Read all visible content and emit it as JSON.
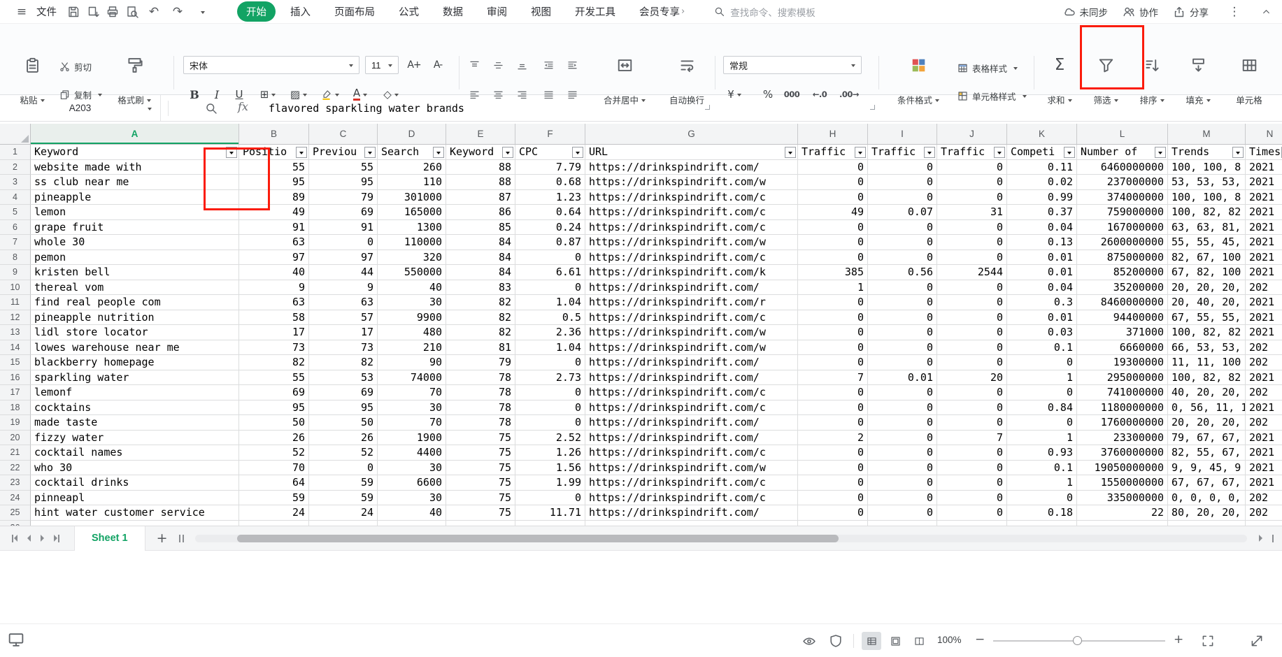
{
  "colors": {
    "accent_green": "#12a364",
    "annotation_red": "#fb1c0c"
  },
  "glyphs": {
    "hamburger": "≡",
    "undo": "↶",
    "redo": "↷",
    "kebab": "⋮",
    "chev_right": "›",
    "bold": "B",
    "italic": "I",
    "underline": "U",
    "borders": "⊞",
    "shading": "▨",
    "clear_format": "◇",
    "font_color": "A",
    "grow_font": "A+",
    "shrink_font": "A-",
    "sigma": "Σ",
    "currency": "¥",
    "percent": "%",
    "thousands": "000",
    "add_decimal": "←.0",
    "remove_decimal": ".00→",
    "fx": "fx",
    "plus": "+",
    "minus": "−"
  },
  "menubar": {
    "file": "文件",
    "tabs": [
      {
        "label": "开始",
        "active": true
      },
      {
        "label": "插入"
      },
      {
        "label": "页面布局"
      },
      {
        "label": "公式"
      },
      {
        "label": "数据"
      },
      {
        "label": "审阅"
      },
      {
        "label": "视图"
      },
      {
        "label": "开发工具"
      },
      {
        "label": "会员专享"
      }
    ],
    "search_placeholder": "查找命令、搜索模板",
    "sync_status": "未同步",
    "collaborate": "协作",
    "share": "分享"
  },
  "ribbon": {
    "paste": "粘贴",
    "cut": "剪切",
    "copy": "复制",
    "format_painter": "格式刷",
    "font_name": "宋体",
    "font_size": "11",
    "merge_center": "合并居中",
    "wrap_text": "自动换行",
    "number_format": "常规",
    "conditional_format": "条件格式",
    "table_style": "表格样式",
    "cell_style": "单元格样式",
    "sum": "求和",
    "filter": "筛选",
    "sort": "排序",
    "fill": "填充",
    "cells": "单元格"
  },
  "formula_bar": {
    "cell_ref": "A203",
    "content": "flavored sparkling water brands"
  },
  "sheet": {
    "active_column": "A",
    "column_letters": [
      "A",
      "B",
      "C",
      "D",
      "E",
      "F",
      "G",
      "H",
      "I",
      "J",
      "K",
      "L",
      "M",
      "N"
    ],
    "header_row": {
      "n": 1,
      "cells": [
        "Keyword",
        "Positio",
        "Previou",
        "Search",
        "Keyword",
        "CPC",
        "URL",
        "Traffic",
        "Traffic",
        "Traffic",
        "Competi",
        "Number of",
        "Trends",
        "Timest"
      ]
    },
    "rows": [
      {
        "n": 2,
        "cells": [
          "website made with",
          "55",
          "55",
          "260",
          "88",
          "7.79",
          "https://drinkspindrift.com/",
          "0",
          "0",
          "0",
          "0.11",
          "6460000000",
          "100, 100, 8",
          "2021"
        ]
      },
      {
        "n": 3,
        "cells": [
          "ss club near me",
          "95",
          "95",
          "110",
          "88",
          "0.68",
          "https://drinkspindrift.com/w",
          "0",
          "0",
          "0",
          "0.02",
          "237000000",
          "53, 53, 53,",
          "2021"
        ]
      },
      {
        "n": 4,
        "cells": [
          "pineapple",
          "89",
          "79",
          "301000",
          "87",
          "1.23",
          "https://drinkspindrift.com/c",
          "0",
          "0",
          "0",
          "0.99",
          "374000000",
          "100, 100, 8",
          "2021"
        ]
      },
      {
        "n": 5,
        "cells": [
          "lemon",
          "49",
          "69",
          "165000",
          "86",
          "0.64",
          "https://drinkspindrift.com/c",
          "49",
          "0.07",
          "31",
          "0.37",
          "759000000",
          "100, 82, 82",
          "2021"
        ]
      },
      {
        "n": 6,
        "cells": [
          "grape fruit",
          "91",
          "91",
          "1300",
          "85",
          "0.24",
          "https://drinkspindrift.com/c",
          "0",
          "0",
          "0",
          "0.04",
          "167000000",
          "63, 63, 81,",
          "2021"
        ]
      },
      {
        "n": 7,
        "cells": [
          "whole 30",
          "63",
          "0",
          "110000",
          "84",
          "0.87",
          "https://drinkspindrift.com/w",
          "0",
          "0",
          "0",
          "0.13",
          "2600000000",
          "55, 55, 45,",
          "2021"
        ]
      },
      {
        "n": 8,
        "cells": [
          "pemon",
          "97",
          "97",
          "320",
          "84",
          "0",
          "https://drinkspindrift.com/c",
          "0",
          "0",
          "0",
          "0.01",
          "875000000",
          "82, 67, 100",
          "2021"
        ]
      },
      {
        "n": 9,
        "cells": [
          "kristen bell",
          "40",
          "44",
          "550000",
          "84",
          "6.61",
          "https://drinkspindrift.com/k",
          "385",
          "0.56",
          "2544",
          "0.01",
          "85200000",
          "67, 82, 100",
          "2021"
        ]
      },
      {
        "n": 10,
        "cells": [
          "thereal vom",
          "9",
          "9",
          "40",
          "83",
          "0",
          "https://drinkspindrift.com/",
          "1",
          "0",
          "0",
          "0.04",
          "35200000",
          "20, 20, 20,",
          "202"
        ]
      },
      {
        "n": 11,
        "cells": [
          "find real people com",
          "63",
          "63",
          "30",
          "82",
          "1.04",
          "https://drinkspindrift.com/r",
          "0",
          "0",
          "0",
          "0.3",
          "8460000000",
          "20, 40, 20,",
          "2021"
        ]
      },
      {
        "n": 12,
        "cells": [
          "pineapple nutrition",
          "58",
          "57",
          "9900",
          "82",
          "0.5",
          "https://drinkspindrift.com/c",
          "0",
          "0",
          "0",
          "0.01",
          "94400000",
          "67, 55, 55,",
          "2021"
        ]
      },
      {
        "n": 13,
        "cells": [
          "lidl store locator",
          "17",
          "17",
          "480",
          "82",
          "2.36",
          "https://drinkspindrift.com/w",
          "0",
          "0",
          "0",
          "0.03",
          "371000",
          "100, 82, 82",
          "2021"
        ]
      },
      {
        "n": 14,
        "cells": [
          "lowes warehouse near me",
          "73",
          "73",
          "210",
          "81",
          "1.04",
          "https://drinkspindrift.com/w",
          "0",
          "0",
          "0",
          "0.1",
          "6660000",
          "66, 53, 53,",
          "202"
        ]
      },
      {
        "n": 15,
        "cells": [
          "blackberry homepage",
          "82",
          "82",
          "90",
          "79",
          "0",
          "https://drinkspindrift.com/",
          "0",
          "0",
          "0",
          "0",
          "19300000",
          "11, 11, 100",
          "202"
        ]
      },
      {
        "n": 16,
        "cells": [
          "sparkling water",
          "55",
          "53",
          "74000",
          "78",
          "2.73",
          "https://drinkspindrift.com/",
          "7",
          "0.01",
          "20",
          "1",
          "295000000",
          "100, 82, 82",
          "2021"
        ]
      },
      {
        "n": 17,
        "cells": [
          "lemonf",
          "69",
          "69",
          "70",
          "78",
          "0",
          "https://drinkspindrift.com/c",
          "0",
          "0",
          "0",
          "0",
          "741000000",
          "40, 20, 20,",
          "202"
        ]
      },
      {
        "n": 18,
        "cells": [
          "cocktains",
          "95",
          "95",
          "30",
          "78",
          "0",
          "https://drinkspindrift.com/c",
          "0",
          "0",
          "0",
          "0.84",
          "1180000000",
          "0, 56, 11, 1",
          "2021"
        ]
      },
      {
        "n": 19,
        "cells": [
          "made taste",
          "50",
          "50",
          "70",
          "78",
          "0",
          "https://drinkspindrift.com/",
          "0",
          "0",
          "0",
          "0",
          "1760000000",
          "20, 20, 20,",
          "202"
        ]
      },
      {
        "n": 20,
        "cells": [
          "fizzy water",
          "26",
          "26",
          "1900",
          "75",
          "2.52",
          "https://drinkspindrift.com/",
          "2",
          "0",
          "7",
          "1",
          "23300000",
          "79, 67, 67,",
          "2021"
        ]
      },
      {
        "n": 21,
        "cells": [
          "cocktail names",
          "52",
          "52",
          "4400",
          "75",
          "1.26",
          "https://drinkspindrift.com/c",
          "0",
          "0",
          "0",
          "0.93",
          "3760000000",
          "82, 55, 67,",
          "2021"
        ]
      },
      {
        "n": 22,
        "cells": [
          "who 30",
          "70",
          "0",
          "30",
          "75",
          "1.56",
          "https://drinkspindrift.com/w",
          "0",
          "0",
          "0",
          "0.1",
          "19050000000",
          "9, 9, 45, 9",
          "2021"
        ]
      },
      {
        "n": 23,
        "cells": [
          "cocktail drinks",
          "64",
          "59",
          "6600",
          "75",
          "1.99",
          "https://drinkspindrift.com/c",
          "0",
          "0",
          "0",
          "1",
          "1550000000",
          "67, 67, 67,",
          "2021"
        ]
      },
      {
        "n": 24,
        "cells": [
          "pinneapl",
          "59",
          "59",
          "30",
          "75",
          "0",
          "https://drinkspindrift.com/c",
          "0",
          "0",
          "0",
          "0",
          "335000000",
          "0, 0, 0, 0,",
          "202"
        ]
      },
      {
        "n": 25,
        "cells": [
          "hint water customer service",
          "24",
          "24",
          "40",
          "75",
          "11.71",
          "https://drinkspindrift.com/",
          "0",
          "0",
          "0",
          "0.18",
          "22",
          "80, 20, 20,",
          "202"
        ]
      },
      {
        "n": 26,
        "cells": [
          "",
          "",
          "",
          "",
          "",
          "",
          "",
          "",
          "",
          "",
          "",
          "",
          "",
          ""
        ]
      }
    ]
  },
  "sheet_bar": {
    "active_tab": "Sheet 1"
  },
  "status_bar": {
    "zoom": "100%"
  },
  "annotations": {
    "color": "#fb1c0c",
    "targets": [
      "ribbon-filter-button",
      "keyword-column-filter-dropdown"
    ]
  }
}
